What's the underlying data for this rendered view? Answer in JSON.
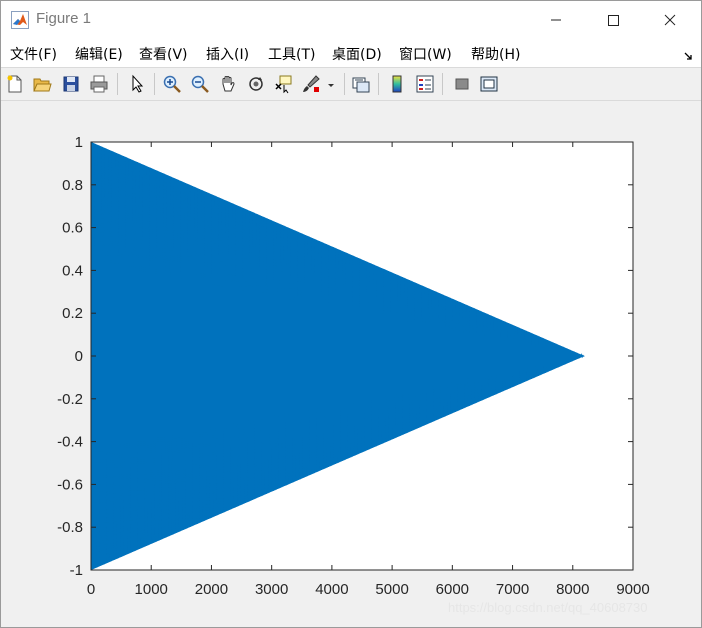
{
  "window": {
    "title": "Figure 1"
  },
  "menu": [
    {
      "label": "文件(F)"
    },
    {
      "label": "编辑(E)"
    },
    {
      "label": "查看(V)"
    },
    {
      "label": "插入(I)"
    },
    {
      "label": "工具(T)"
    },
    {
      "label": "桌面(D)"
    },
    {
      "label": "窗口(W)"
    },
    {
      "label": "帮助(H)"
    }
  ],
  "toolbar": [
    {
      "icon": "new-figure-icon"
    },
    {
      "icon": "open-file-icon"
    },
    {
      "icon": "save-icon"
    },
    {
      "icon": "print-icon"
    },
    {
      "icon": "pointer-icon"
    },
    {
      "icon": "zoom-in-icon"
    },
    {
      "icon": "zoom-out-icon"
    },
    {
      "icon": "pan-hand-icon"
    },
    {
      "icon": "rotate-3d-icon"
    },
    {
      "icon": "data-cursor-icon"
    },
    {
      "icon": "brush-icon"
    },
    {
      "icon": "link-plot-icon"
    },
    {
      "icon": "colorbar-icon"
    },
    {
      "icon": "legend-icon"
    },
    {
      "icon": "hide-plot-tools-icon"
    },
    {
      "icon": "show-plot-tools-icon"
    }
  ],
  "chart_data": {
    "type": "line",
    "title": "",
    "xlabel": "",
    "ylabel": "",
    "xlim": [
      0,
      9000
    ],
    "ylim": [
      -1,
      1
    ],
    "xticks": [
      0,
      1000,
      2000,
      3000,
      4000,
      5000,
      6000,
      7000,
      8000,
      9000
    ],
    "yticks": [
      -1,
      -0.8,
      -0.6,
      -0.4,
      -0.2,
      0,
      0.2,
      0.4,
      0.6,
      0.8,
      1
    ],
    "xtick_labels": [
      "0",
      "1000",
      "2000",
      "3000",
      "4000",
      "5000",
      "6000",
      "7000",
      "8000",
      "9000"
    ],
    "ytick_labels": [
      "-1",
      "-0.8",
      "-0.6",
      "-0.4",
      "-0.2",
      "0",
      "0.2",
      "0.4",
      "0.6",
      "0.8",
      "1"
    ],
    "grid": false,
    "series": [
      {
        "color": "#0072BD",
        "x": [
          0,
          8192
        ],
        "envelope_upper": [
          1,
          0
        ],
        "envelope_lower": [
          -1,
          0
        ],
        "description_of_signal": "densely oscillating signal with linearly decaying amplitude"
      }
    ]
  },
  "watermark": "https://blog.csdn.net/qq_40608730"
}
